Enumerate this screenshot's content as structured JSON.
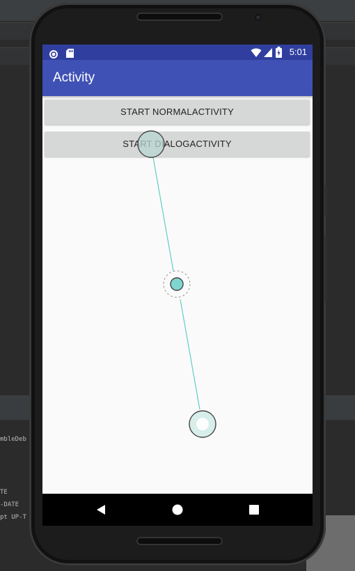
{
  "ide": {
    "console_lines": [
      "mbleDeb",
      "TE",
      "-DATE",
      "pt UP-T"
    ]
  },
  "status_bar": {
    "time": "5:01",
    "icons": [
      "record-icon",
      "sd-card-icon",
      "wifi-icon",
      "battery-charging-icon"
    ]
  },
  "app_bar": {
    "title": "Activity"
  },
  "buttons": {
    "start_normal": "START NORMALACTIVITY",
    "start_dialog": "START DIALOGACTIVITY"
  },
  "nav_bar": {
    "icons": [
      "back-icon",
      "home-icon",
      "recents-icon"
    ]
  },
  "colors": {
    "primary": "#3f51b5",
    "primary_dark": "#303f9f",
    "touch_accent": "#7fd6cf",
    "button": "#d6d7d7"
  }
}
